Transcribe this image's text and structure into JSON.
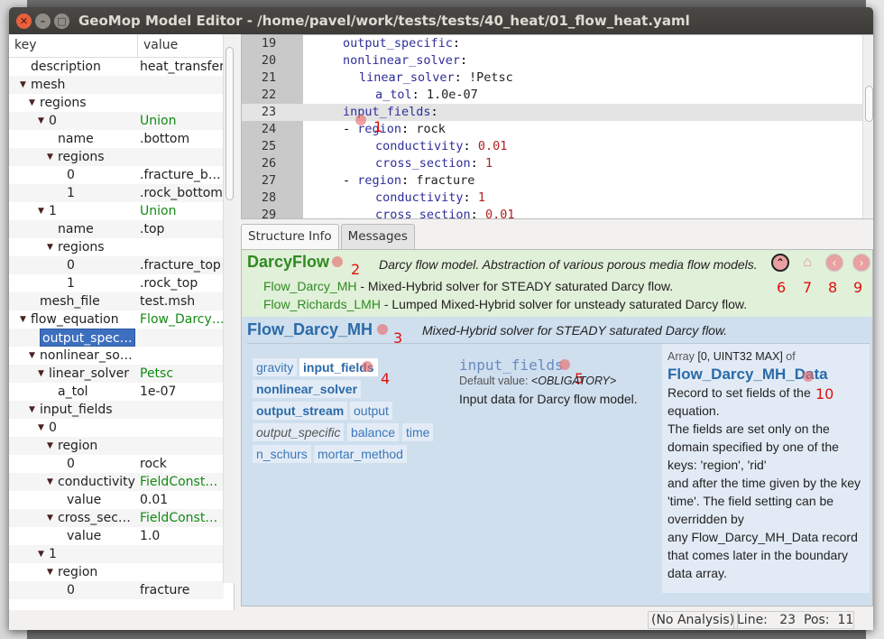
{
  "window": {
    "title": "GeoMop Model Editor - /home/pavel/work/tests/tests/40_heat/01_flow_heat.yaml"
  },
  "tree": {
    "col_key": "key",
    "col_value": "value",
    "rows": [
      {
        "d": 0,
        "k": "description",
        "v": "heat_transfer",
        "exp": false
      },
      {
        "d": 0,
        "k": "mesh",
        "v": "",
        "exp": true
      },
      {
        "d": 1,
        "k": "regions",
        "v": "",
        "exp": true
      },
      {
        "d": 2,
        "k": "0",
        "v": "Union",
        "exp": true,
        "type": true
      },
      {
        "d": 3,
        "k": "name",
        "v": ".bottom",
        "exp": false
      },
      {
        "d": 3,
        "k": "regions",
        "v": "",
        "exp": true
      },
      {
        "d": 4,
        "k": "0",
        "v": ".fracture_b…",
        "exp": false
      },
      {
        "d": 4,
        "k": "1",
        "v": ".rock_bottom",
        "exp": false
      },
      {
        "d": 2,
        "k": "1",
        "v": "Union",
        "exp": true,
        "type": true
      },
      {
        "d": 3,
        "k": "name",
        "v": ".top",
        "exp": false
      },
      {
        "d": 3,
        "k": "regions",
        "v": "",
        "exp": true
      },
      {
        "d": 4,
        "k": "0",
        "v": ".fracture_top",
        "exp": false
      },
      {
        "d": 4,
        "k": "1",
        "v": ".rock_top",
        "exp": false
      },
      {
        "d": 1,
        "k": "mesh_file",
        "v": "test.msh",
        "exp": false
      },
      {
        "d": 0,
        "k": "flow_equation",
        "v": "Flow_Darcy…",
        "exp": true,
        "type": true
      },
      {
        "d": 1,
        "k": "output_spec…",
        "v": "",
        "exp": false,
        "selected": true
      },
      {
        "d": 1,
        "k": "nonlinear_so…",
        "v": "",
        "exp": true
      },
      {
        "d": 2,
        "k": "linear_solver",
        "v": "Petsc",
        "exp": true,
        "type": true
      },
      {
        "d": 3,
        "k": "a_tol",
        "v": "1e-07",
        "exp": false
      },
      {
        "d": 1,
        "k": "input_fields",
        "v": "",
        "exp": true
      },
      {
        "d": 2,
        "k": "0",
        "v": "",
        "exp": true
      },
      {
        "d": 3,
        "k": "region",
        "v": "",
        "exp": true
      },
      {
        "d": 4,
        "k": "0",
        "v": "rock",
        "exp": false
      },
      {
        "d": 3,
        "k": "conductivity",
        "v": "FieldConst…",
        "exp": true,
        "type": true
      },
      {
        "d": 4,
        "k": "value",
        "v": "0.01",
        "exp": false
      },
      {
        "d": 3,
        "k": "cross_sec…",
        "v": "FieldConst…",
        "exp": true,
        "type": true
      },
      {
        "d": 4,
        "k": "value",
        "v": "1.0",
        "exp": false
      },
      {
        "d": 2,
        "k": "1",
        "v": "",
        "exp": true
      },
      {
        "d": 3,
        "k": "region",
        "v": "",
        "exp": true
      },
      {
        "d": 4,
        "k": "0",
        "v": "fracture",
        "exp": false
      }
    ]
  },
  "editor": {
    "current_line": 23,
    "lines": [
      {
        "n": "19",
        "i": 0,
        "key": "output_specific",
        "sep": ":",
        "val": "",
        "vt": ""
      },
      {
        "n": "20",
        "i": 0,
        "key": "nonlinear_solver",
        "sep": ":",
        "val": "",
        "vt": ""
      },
      {
        "n": "21",
        "i": 1,
        "key": "linear_solver",
        "sep": ": ",
        "val": "!Petsc",
        "vt": "str"
      },
      {
        "n": "22",
        "i": 2,
        "key": "a_tol",
        "sep": ": ",
        "val": "1.0e-07",
        "vt": "str"
      },
      {
        "n": "23",
        "i": 0,
        "key": "input_fields",
        "sep": ":",
        "val": "",
        "vt": ""
      },
      {
        "n": "24",
        "i": 1,
        "dash": true,
        "key": "region",
        "sep": ": ",
        "val": "rock",
        "vt": "str"
      },
      {
        "n": "25",
        "i": 2,
        "key": "conductivity",
        "sep": ": ",
        "val": "0.01",
        "vt": "num"
      },
      {
        "n": "26",
        "i": 2,
        "key": "cross_section",
        "sep": ": ",
        "val": "1",
        "vt": "num"
      },
      {
        "n": "27",
        "i": 1,
        "dash": true,
        "key": "region",
        "sep": ": ",
        "val": "fracture",
        "vt": "str"
      },
      {
        "n": "28",
        "i": 2,
        "key": "conductivity",
        "sep": ": ",
        "val": "1",
        "vt": "num"
      },
      {
        "n": "29",
        "i": 2,
        "key": "cross_section",
        "sep": ": ",
        "val": "0.01",
        "vt": "num"
      }
    ]
  },
  "tabs": [
    "Structure Info",
    "Messages"
  ],
  "info": {
    "parent": {
      "name": "DarcyFlow",
      "description": "Darcy flow model. Abstraction of various porous media flow models.",
      "options": [
        {
          "name": "Flow_Darcy_MH",
          "desc": " - Mixed-Hybrid solver for STEADY saturated Darcy flow."
        },
        {
          "name": "Flow_Richards_LMH",
          "desc": " - Lumped Mixed-Hybrid solver for unsteady saturated Darcy flow."
        }
      ]
    },
    "nav": {
      "up": "chevron-up-icon",
      "home": "home-icon",
      "back": "chevron-left-icon",
      "forward": "chevron-right-icon"
    },
    "record": {
      "name": "Flow_Darcy_MH",
      "description": "Mixed-Hybrid solver for STEADY saturated Darcy flow.",
      "keys": [
        "gravity",
        "input_fields",
        "nonlinear_solver",
        "output_stream",
        "output",
        "output_specific",
        "balance",
        "time",
        "n_schurs",
        "mortar_method"
      ]
    },
    "key": {
      "name": "input_fields",
      "default_label": "Default value: ",
      "default_value": "<OBLIGATORY>",
      "description": "Input data for Darcy flow model."
    },
    "type": {
      "prefix": "Array ",
      "range": "[0, UINT32 MAX]",
      "of": " of",
      "name": "Flow_Darcy_MH_Data",
      "lines": [
        "Record to set fields of the equation.",
        "The fields are set only on the",
        "domain specified by one of the",
        "keys: 'region', 'rid'",
        "and after the time given by the key",
        "'time'. The field setting can be",
        "overridden by",
        "any Flow_Darcy_MH_Data record",
        "that comes later in the boundary",
        "data array."
      ]
    }
  },
  "markers": [
    "1",
    "2",
    "3",
    "4",
    "5",
    "6",
    "7",
    "8",
    "9",
    "10"
  ],
  "status": {
    "analysis": "(No Analysis)",
    "line_label": "Line:",
    "line": "23",
    "pos_label": "Pos:",
    "pos": "11"
  }
}
